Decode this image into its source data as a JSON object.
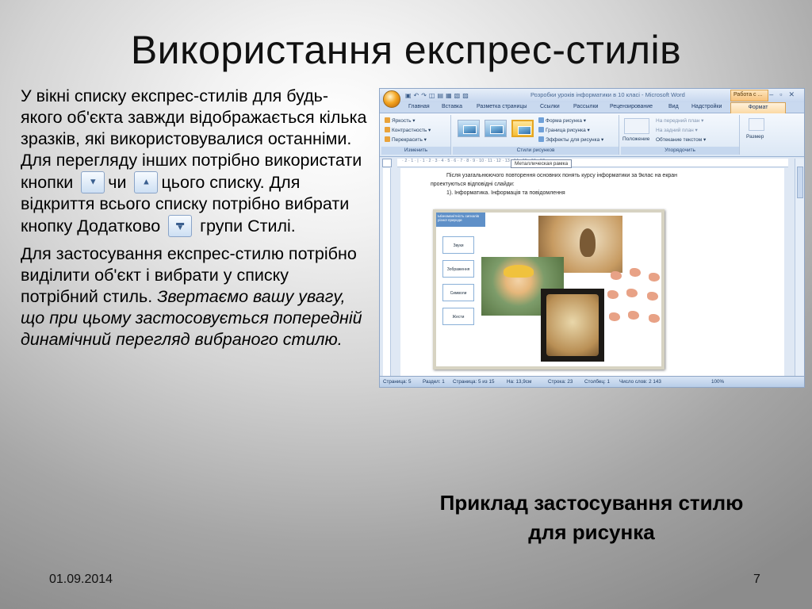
{
  "slide": {
    "title": "Використання експрес-стилів",
    "para1_a": "У вікні списку експрес-стилів для будь-якого об'єкта завжди відображається кілька зразків, які використовувалися останніми. Для перегляду інших потрібно використати кнопки",
    "para1_b": "чи",
    "para1_c": "цього списку. Для відкриття всього списку потрібно вибрати кнопку Додатково",
    "para1_d": "групи Стилі.",
    "para2_plain": "Для застосування експрес-стилю потрібно виділити об'єкт і вибрати у списку потрібний стиль.",
    "para2_italic": "Звертаємо вашу увагу, що при цьому застосовується попередній динамічний перегляд вибраного стилю.",
    "caption_line1": "Приклад застосування стилю",
    "caption_line2": "для рисунка",
    "date": "01.09.2014",
    "page_number": "7",
    "icons": {
      "scroll_down": "down-arrow-icon",
      "scroll_up": "up-arrow-icon",
      "more": "more-icon"
    }
  },
  "word_window": {
    "title": "Розробки уроків інформатики в 10 класі - Microsoft Word",
    "context_tab": "Работа с ...",
    "tabs": [
      "Главная",
      "Вставка",
      "Разметка страницы",
      "Ссылки",
      "Рассылки",
      "Рецензирование",
      "Вид",
      "Надстройки",
      "Формат"
    ],
    "active_tab": "Формат",
    "ribbon": {
      "adjust": {
        "items": [
          "Яркость",
          "Контрастность",
          "Перекрасить"
        ],
        "label": "Изменить"
      },
      "styles": {
        "items": [
          "Форма рисунка",
          "Граница рисунка",
          "Эффекты для рисунка"
        ],
        "label": "Стили рисунков"
      },
      "arrange": {
        "position": "Положение",
        "items": [
          "На передний план",
          "На задний план",
          "Обтекание текстом"
        ],
        "label": "Упорядочить"
      },
      "size": "Размер"
    },
    "tooltip": "Металлическая рамка",
    "document": {
      "line1": "Після узагальнюючого повторення основних понять курсу інформатики за 9клас на екран",
      "line2": "проектуються відповідні слайди:",
      "line3": "1). Інформатика. Інформація та повідомлення",
      "diagram_header": "Ыізноманітність сигналів різної природи",
      "diagram_items": [
        "Звуки",
        "Зображення",
        "Символи",
        "Жести"
      ]
    },
    "status": {
      "page": "Страница: 5",
      "section": "Раздел: 1",
      "pages": "Страница: 5 из 15",
      "at": "На: 13,9см",
      "line": "Строка: 23",
      "column": "Столбец: 1",
      "words": "Число слов: 2 143",
      "zoom": "100%"
    }
  }
}
